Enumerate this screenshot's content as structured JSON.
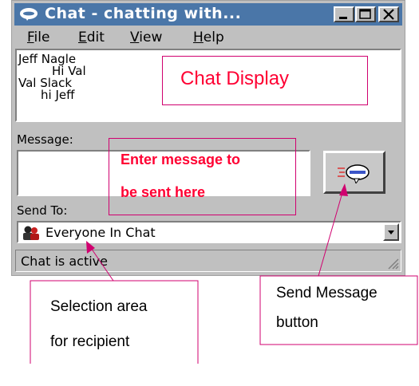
{
  "window": {
    "title": "Chat - chatting with...",
    "menu": [
      "File",
      "Edit",
      "View",
      "Help"
    ]
  },
  "chat": {
    "lines": [
      {
        "text": "Jeff Nagle"
      },
      {
        "text": "Hi Val"
      },
      {
        "text": "Val Slack"
      },
      {
        "text": "hi Jeff"
      }
    ]
  },
  "message_label": "Message:",
  "send_to_label": "Send To:",
  "recipient": "Everyone In Chat",
  "status": "Chat is active",
  "annotations": {
    "chat_display": "Chat Display",
    "enter_message_line1": "Enter message to",
    "enter_message_line2": "be sent here",
    "selection_line1": "Selection area",
    "selection_line2": "for recipient",
    "send_line1": "Send Message",
    "send_line2": "button"
  },
  "icons": {
    "title": "chat-bubble-icon",
    "send": "send-message-icon",
    "recipient": "people-icon",
    "dropdown": "triangle-down-icon",
    "grip": "resize-grip-icon"
  },
  "colors": {
    "titlebar": "#4a76a8",
    "window_face": "#c0c0c0",
    "annotation_border": "#d0006f",
    "annotation_text": "#ff0033"
  }
}
